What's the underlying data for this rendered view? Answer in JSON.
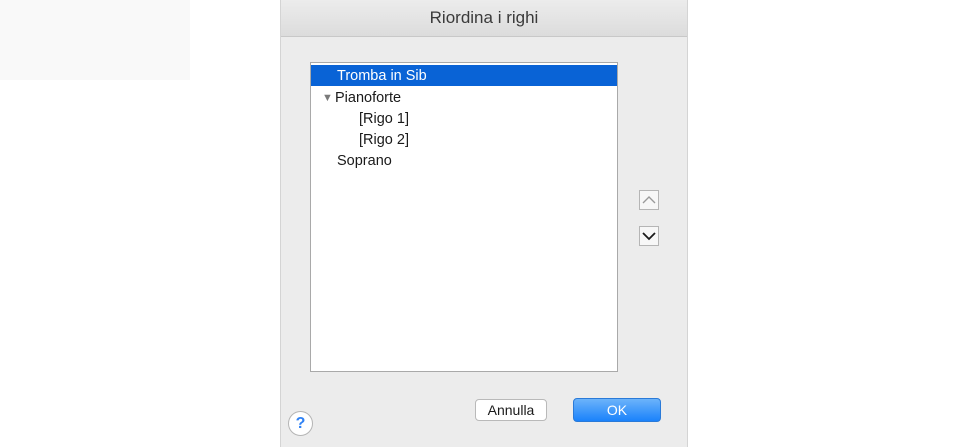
{
  "dialog": {
    "title": "Riordina i righi",
    "list": [
      {
        "label": "Tromba in Sib",
        "selected": true
      },
      {
        "label": "Pianoforte",
        "expanded": true
      },
      {
        "label": "[Rigo 1]"
      },
      {
        "label": "[Rigo 2]"
      },
      {
        "label": "Soprano"
      }
    ],
    "move_up_icon": "chevron-up-icon",
    "move_down_icon": "chevron-down-icon",
    "cancel_label": "Annulla",
    "ok_label": "OK",
    "help_label": "?",
    "colors": {
      "selection": "#0963d6",
      "ok_button": "#1a82fb",
      "help_icon": "#2f82f5"
    }
  }
}
